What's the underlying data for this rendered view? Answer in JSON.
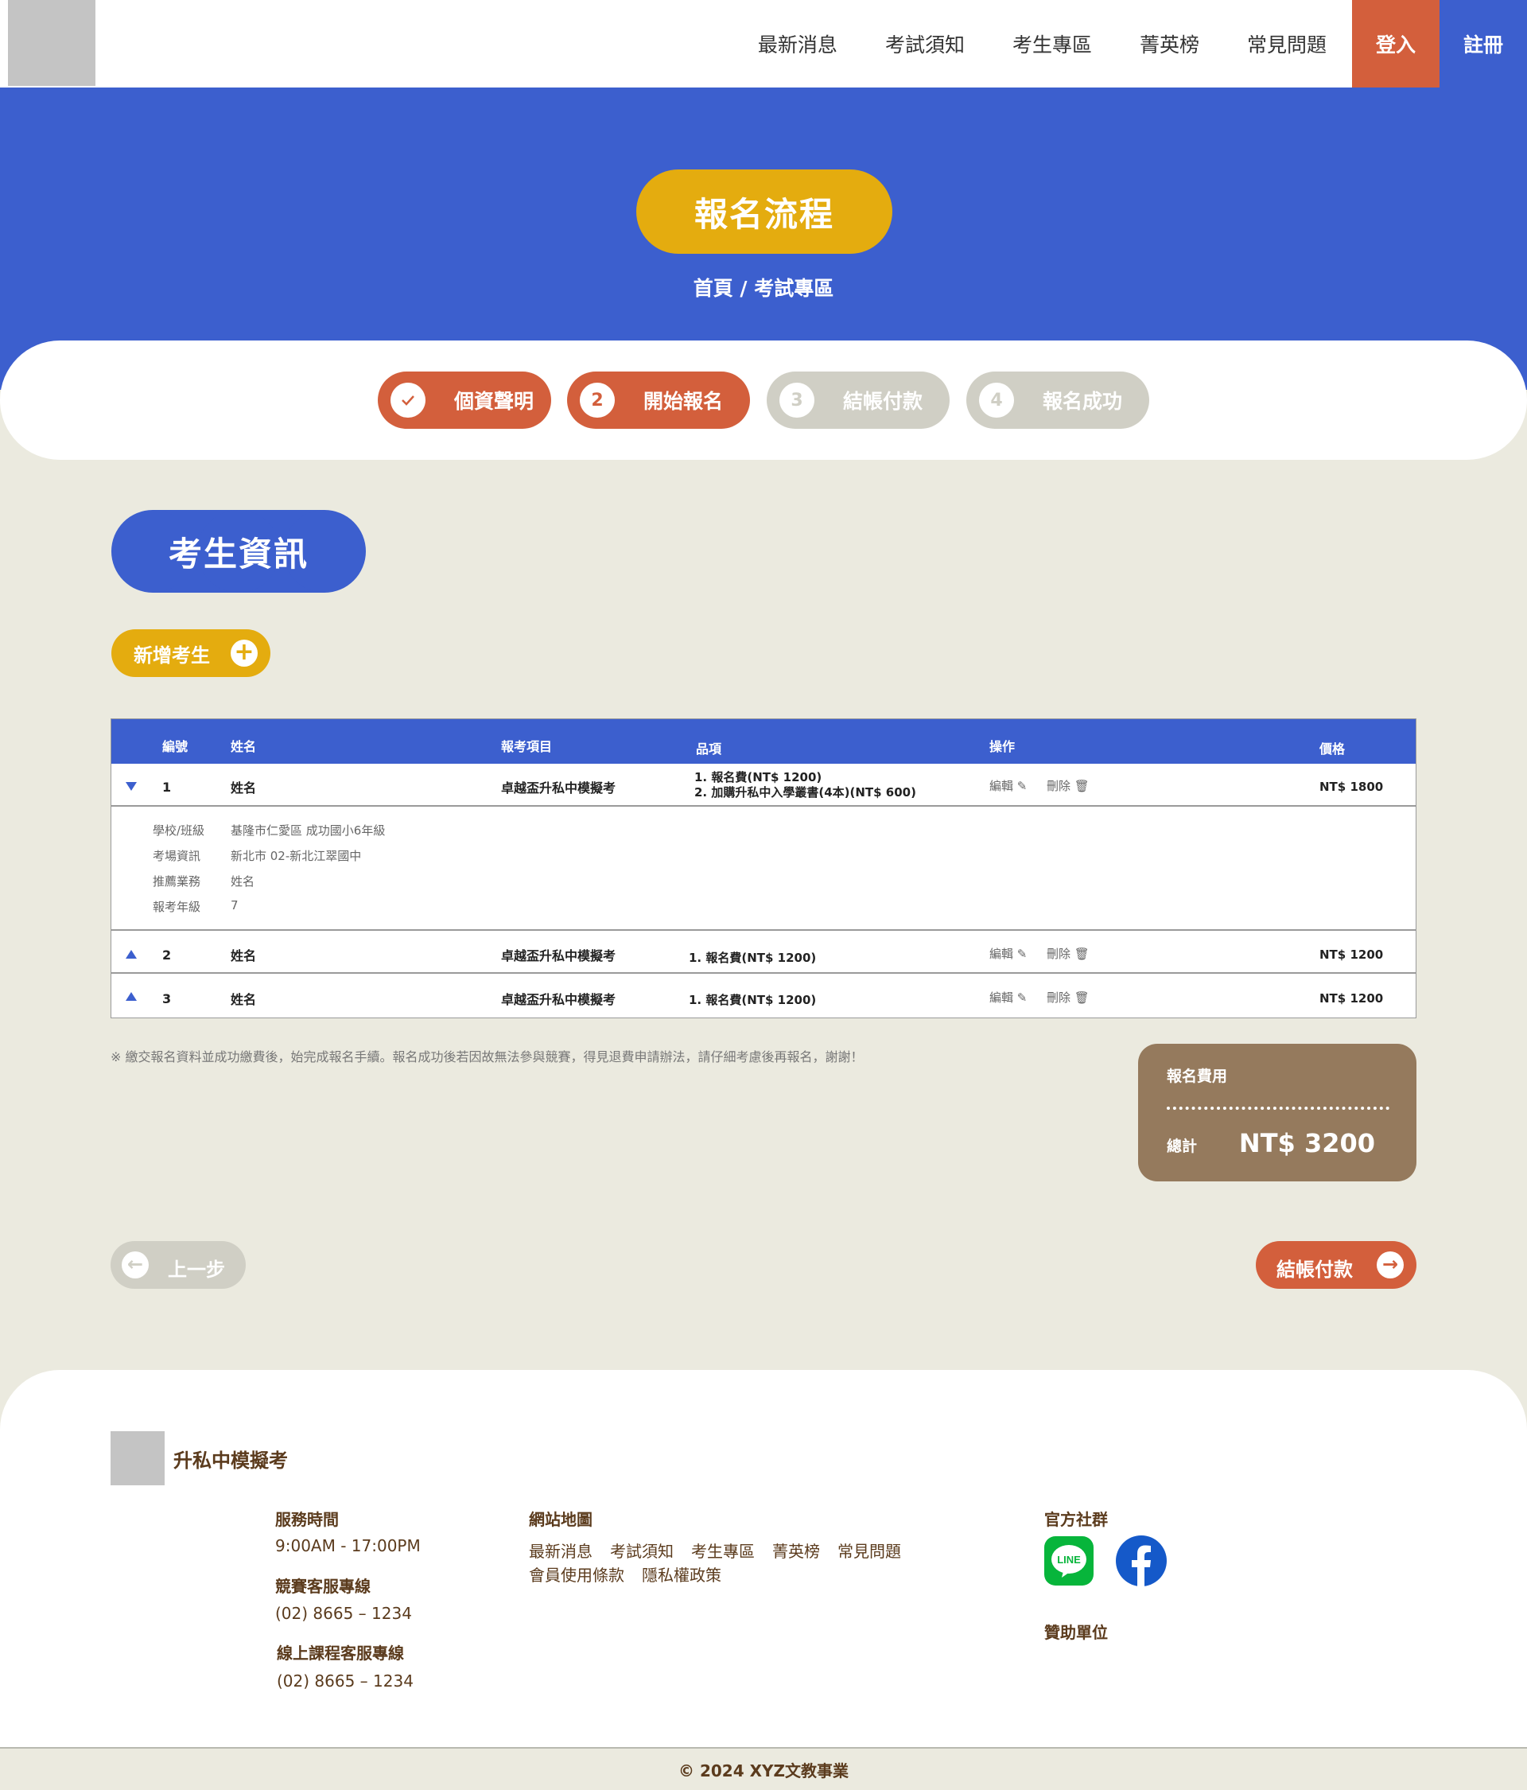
{
  "header": {
    "nav": [
      "最新消息",
      "考試須知",
      "考生專區",
      "菁英榜",
      "常見問題"
    ],
    "login_label": "登入",
    "register_label": "註冊"
  },
  "hero": {
    "title": "報名流程",
    "breadcrumb": "首頁 / 考試專區"
  },
  "steps": [
    {
      "num": "✓",
      "label": "個資聲明",
      "state": "active"
    },
    {
      "num": "2",
      "label": "開始報名",
      "state": "active"
    },
    {
      "num": "3",
      "label": "結帳付款",
      "state": "inactive"
    },
    {
      "num": "4",
      "label": "報名成功",
      "state": "inactive"
    }
  ],
  "section": {
    "title": "考生資訊",
    "add_label": "新增考生"
  },
  "table": {
    "headers": {
      "no": "編號",
      "name": "姓名",
      "item": "報考項目",
      "products": "品項",
      "ops": "操作",
      "price": "價格"
    },
    "rows": [
      {
        "no": "1",
        "name": "姓名",
        "item": "卓越盃升私中模擬考",
        "product_1": "1. 報名費(NT$ 1200)",
        "product_2": "2. 加購升私中入學叢書(4本)(NT$ 600)",
        "edit": "編輯",
        "delete": "刪除",
        "price": "NT$ 1800",
        "details": [
          {
            "label": "學校/班級",
            "value": "基隆市仁愛區 成功國小6年級"
          },
          {
            "label": "考場資訊",
            "value": "新北市 02-新北江翠國中"
          },
          {
            "label": "推薦業務",
            "value": "姓名"
          },
          {
            "label": "報考年級",
            "value": "7"
          }
        ]
      },
      {
        "no": "2",
        "name": "姓名",
        "item": "卓越盃升私中模擬考",
        "product_1": "1. 報名費(NT$ 1200)",
        "edit": "編輯",
        "delete": "刪除",
        "price": "NT$ 1200"
      },
      {
        "no": "3",
        "name": "姓名",
        "item": "卓越盃升私中模擬考",
        "product_1": "1. 報名費(NT$ 1200)",
        "edit": "編輯",
        "delete": "刪除",
        "price": "NT$ 1200"
      }
    ]
  },
  "notice": "※ 繳交報名資料並成功繳費後，始完成報名手續。報名成功後若因故無法參與競賽，得見退費申請辦法，請仔細考慮後再報名，謝謝！",
  "fee": {
    "title": "報名費用",
    "total_label": "總計",
    "total_value": "NT$ 3200"
  },
  "nav_buttons": {
    "prev": "上一步",
    "next": "結帳付款"
  },
  "footer": {
    "brand": "升私中模擬考",
    "hours_title": "服務時間",
    "hours": "9:00AM - 17:00PM",
    "hotline_title": "競賽客服專線",
    "hotline": "(02) 8665 – 1234",
    "online_title": "線上課程客服專線",
    "online": "(02) 8665 – 1234",
    "sitemap_title": "網站地圖",
    "sitemap_row1": [
      "最新消息",
      "考試須知",
      "考生專區",
      "菁英榜",
      "常見問題"
    ],
    "sitemap_row2": [
      "會員使用條款",
      "隱私權政策"
    ],
    "social_title": "官方社群",
    "sponsor_title": "贊助單位",
    "line_text": "LINE",
    "copyright": "© 2024 XYZ文教事業"
  },
  "colors": {
    "blue": "#3c5fce",
    "orange": "#d35f3c",
    "yellow": "#e4ac0f",
    "brown": "#957a5d",
    "gray": "#d0cfc5"
  }
}
